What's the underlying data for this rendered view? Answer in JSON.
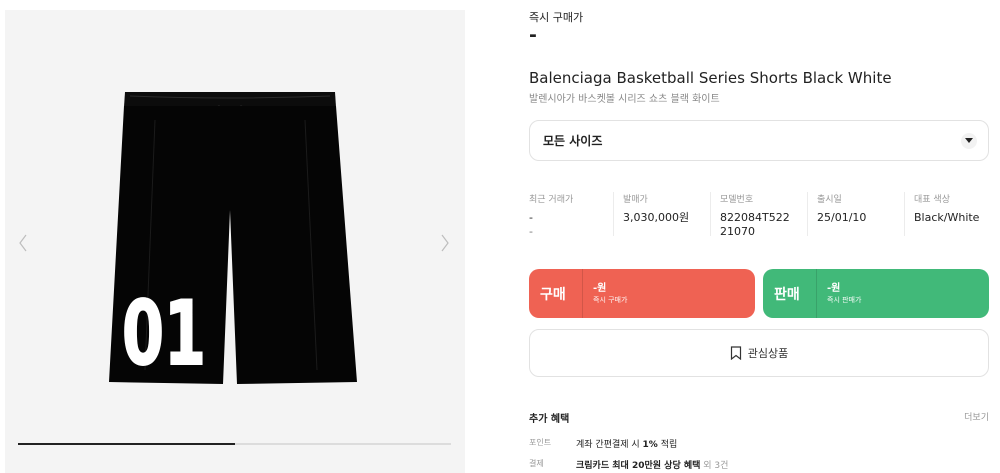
{
  "gallery": {
    "product_number_text": "01",
    "progress": 0.5,
    "prev_icon": "chevron-left-icon",
    "next_icon": "chevron-right-icon"
  },
  "instant": {
    "label": "즉시 구매가",
    "price": "-"
  },
  "product": {
    "title_en": "Balenciaga Basketball Series Shorts Black White",
    "title_ko": "발렌시아가 바스켓볼 시리즈 쇼츠 블랙 화이트"
  },
  "size_select": {
    "value": "모든 사이즈",
    "icon": "chevron-down-icon"
  },
  "specs": [
    {
      "key": "최근 거래가",
      "v1": "-",
      "v2": "-"
    },
    {
      "key": "발매가",
      "v1": "3,030,000원",
      "v2": ""
    },
    {
      "key": "모델번호",
      "v1": "822084T522",
      "v2": "21070"
    },
    {
      "key": "출시일",
      "v1": "25/01/10",
      "v2": ""
    },
    {
      "key": "대표 색상",
      "v1": "Black/White",
      "v2": ""
    }
  ],
  "buy": {
    "label": "구매",
    "price": "-원",
    "sub": "즉시 구매가",
    "color": "#ef6253"
  },
  "sell": {
    "label": "판매",
    "price": "-원",
    "sub": "즉시 판매가",
    "color": "#41b979"
  },
  "wishlist": {
    "label": "관심상품",
    "icon": "bookmark-icon"
  },
  "benefits": {
    "title": "추가 혜택",
    "more": "더보기",
    "rows": [
      {
        "key": "포인트",
        "pre": "계좌 간편결제 시 ",
        "bold": "1%",
        "post": " 적립",
        "extra": ""
      },
      {
        "key": "결제",
        "pre": "크림카드 최대 20만원 상당 혜택",
        "bold": "",
        "post": "",
        "extra": " 외 3건"
      }
    ]
  }
}
